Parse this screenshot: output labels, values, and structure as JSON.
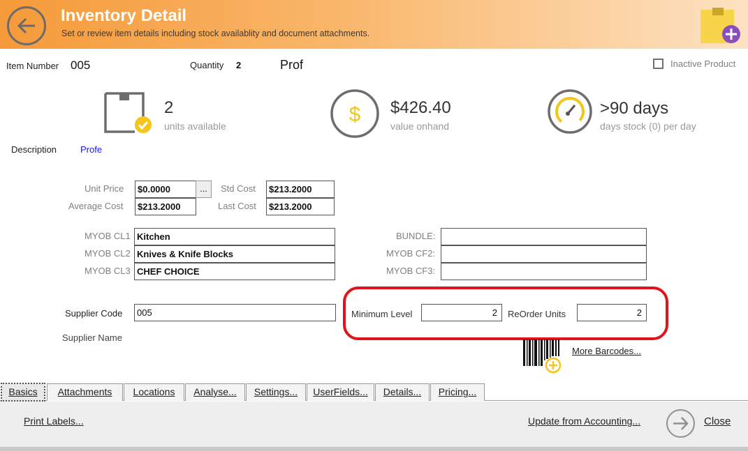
{
  "header": {
    "title": "Inventory Detail",
    "subtitle": "Set or review item details including stock availablity and document attachments."
  },
  "item": {
    "number_label": "Item Number",
    "number_value": "005",
    "quantity_label": "Quantity",
    "quantity_value": "2",
    "name_partial": "Prof",
    "inactive_label": "Inactive Product"
  },
  "stats": {
    "units": {
      "value": "2",
      "caption": "units available"
    },
    "value": {
      "value": "$426.40",
      "caption": "value onhand"
    },
    "days": {
      "value": ">90 days",
      "caption": "days stock (0) per day"
    }
  },
  "description": {
    "label": "Description",
    "value": "Profe"
  },
  "pricing": {
    "unit_price_label": "Unit Price",
    "unit_price": "$0.0000",
    "ellipsis": "...",
    "std_cost_label": "Std Cost",
    "std_cost": "$213.2000",
    "avg_cost_label": "Average Cost",
    "avg_cost": "$213.2000",
    "last_cost_label": "Last Cost",
    "last_cost": "$213.2000"
  },
  "custom": {
    "cl1_label": "MYOB CL1",
    "cl1": "Kitchen",
    "cl2_label": "MYOB CL2",
    "cl2": "Knives & Knife Blocks",
    "cl3_label": "MYOB CL3",
    "cl3": "CHEF CHOICE",
    "bundle_label": "BUNDLE:",
    "bundle": "",
    "cf2_label": "MYOB CF2:",
    "cf2": "",
    "cf3_label": "MYOB CF3:",
    "cf3": ""
  },
  "supplier": {
    "code_label": "Supplier Code",
    "code": "005",
    "name_label": "Supplier Name"
  },
  "levels": {
    "min_label": "Minimum Level",
    "min": "2",
    "reorder_label": "ReOrder Units",
    "reorder": "2"
  },
  "barcodes_link": "More Barcodes...",
  "tabs": [
    "Basics",
    "Attachments",
    "Locations",
    "Analyse...",
    "Settings...",
    "UserFields...",
    "Details...",
    "Pricing..."
  ],
  "footer": {
    "print_labels": "Print Labels...",
    "update": "Update from Accounting...",
    "close": "Close"
  },
  "colors": {
    "header_orange": "#f59a3a",
    "accent_yellow": "#f5c518",
    "highlight_red": "#e0151b",
    "link_blue": "#1a1aff"
  }
}
